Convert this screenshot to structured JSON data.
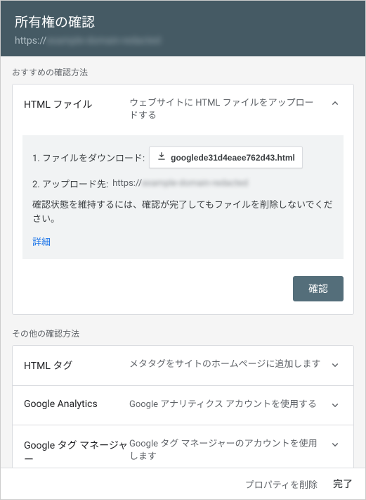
{
  "header": {
    "title": "所有権の確認",
    "url_prefix": "https://",
    "url_blurred": "example-domain-redacted"
  },
  "sections": {
    "recommended_label": "おすすめの確認方法",
    "other_label": "その他の確認方法"
  },
  "recommended": {
    "name": "HTML ファイル",
    "desc": "ウェブサイトに HTML ファイルをアップロードする",
    "step1_label": "1. ファイルをダウンロード:",
    "download_filename": "googlede31d4eaee762d43.html",
    "step2_label": "2. アップロード先:",
    "step2_url_prefix": "https://",
    "step2_url_blurred": "example-domain-redacted",
    "note": "確認状態を維持するには、確認が完了してもファイルを削除しないでください。",
    "detail": "詳細",
    "confirm": "確認"
  },
  "other_methods": [
    {
      "name": "HTML タグ",
      "desc": "メタタグをサイトのホームページに追加します"
    },
    {
      "name": "Google Analytics",
      "desc": "Google アナリティクス アカウントを使用する"
    },
    {
      "name": "Google タグ マネージャー",
      "desc": "Google タグ マネージャーのアカウントを使用します"
    }
  ],
  "footer": {
    "delete": "プロパティを削除",
    "done": "完了"
  }
}
